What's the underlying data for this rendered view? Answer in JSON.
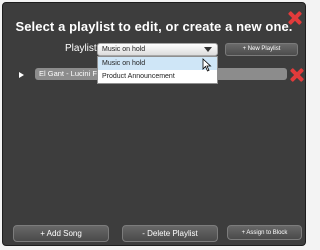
{
  "dialog": {
    "title": "Select a playlist to edit, or create a new one.",
    "playlist_label": "Playlist",
    "selected_playlist": "Music on hold",
    "new_playlist_label": "+ New Playlist"
  },
  "dropdown": {
    "options": [
      "Music on hold",
      "Product Announcement"
    ],
    "highlighted_index": 0
  },
  "track": {
    "name": "El Gant - Lucini Fi"
  },
  "footer": {
    "add_song_label": "+ Add Song",
    "delete_playlist_label": "- Delete Playlist",
    "assign_label": "+ Assign to Block"
  },
  "colors": {
    "dialog_bg": "#3d3d3d",
    "close_red": "#e23b3b",
    "highlight": "#cfe6f7"
  }
}
